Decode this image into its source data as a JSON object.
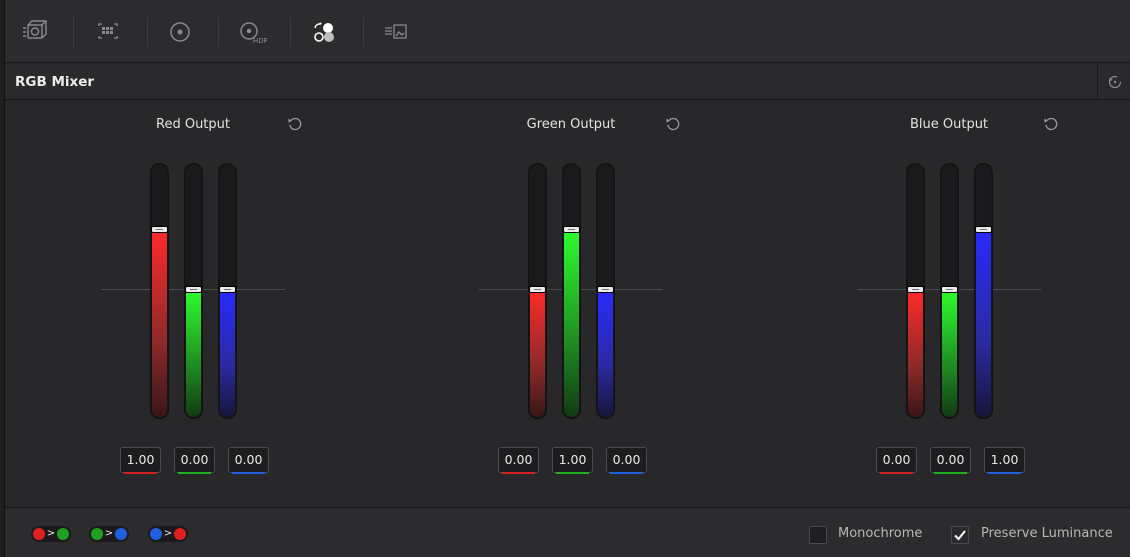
{
  "toolbar": {
    "items": [
      {
        "icon": "camera-raw-icon",
        "active": false
      },
      {
        "icon": "color-match-icon",
        "active": false
      },
      {
        "icon": "color-wheels-icon",
        "active": false
      },
      {
        "icon": "hdr-wheels-icon",
        "active": false,
        "label": "HDR"
      },
      {
        "icon": "rgb-mixer-icon",
        "active": true
      },
      {
        "icon": "motion-effects-icon",
        "active": false
      }
    ]
  },
  "header": {
    "title": "RGB Mixer",
    "reset_icon": "reset-all-icon"
  },
  "groups": [
    {
      "title": "Red Output",
      "values": [
        "1.00",
        "0.00",
        "0.00"
      ],
      "levels": [
        1.0,
        0.0,
        0.0
      ]
    },
    {
      "title": "Green Output",
      "values": [
        "0.00",
        "1.00",
        "0.00"
      ],
      "levels": [
        0.0,
        1.0,
        0.0
      ]
    },
    {
      "title": "Blue Output",
      "values": [
        "0.00",
        "0.00",
        "1.00"
      ],
      "levels": [
        0.0,
        0.0,
        1.0
      ]
    }
  ],
  "channel_colors": {
    "red": "#ff2a2a",
    "green": "#2eff2e",
    "blue": "#2a2aff"
  },
  "value_underline_colors": [
    "#d02020",
    "#20b020",
    "#2060e0"
  ],
  "bottom": {
    "swap_buttons": [
      {
        "icon": "swap-red-green-icon",
        "from": "#e02020",
        "to": "#20a020"
      },
      {
        "icon": "swap-green-blue-icon",
        "from": "#20a020",
        "to": "#2060e0"
      },
      {
        "icon": "swap-blue-red-icon",
        "from": "#2060e0",
        "to": "#e02020"
      }
    ],
    "monochrome": {
      "label": "Monochrome",
      "checked": false
    },
    "preserve_luminance": {
      "label": "Preserve Luminance",
      "checked": true
    }
  }
}
